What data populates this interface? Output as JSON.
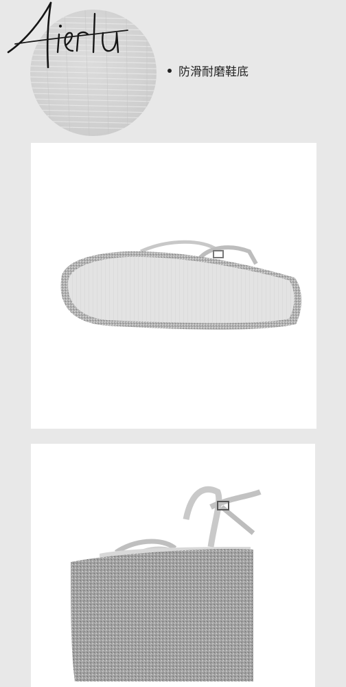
{
  "brand": {
    "logo_text": "Aiertu"
  },
  "feature": {
    "text": "防滑耐磨鞋底"
  },
  "images": [
    {
      "name": "sole-closeup",
      "icon": "sole-texture-icon"
    },
    {
      "name": "shoe-bottom-view"
    },
    {
      "name": "shoe-side-view"
    }
  ],
  "colors": {
    "background": "#e8e8e8",
    "card": "#ffffff",
    "glitter": "#a9a9a9",
    "sole": "#dedede"
  }
}
